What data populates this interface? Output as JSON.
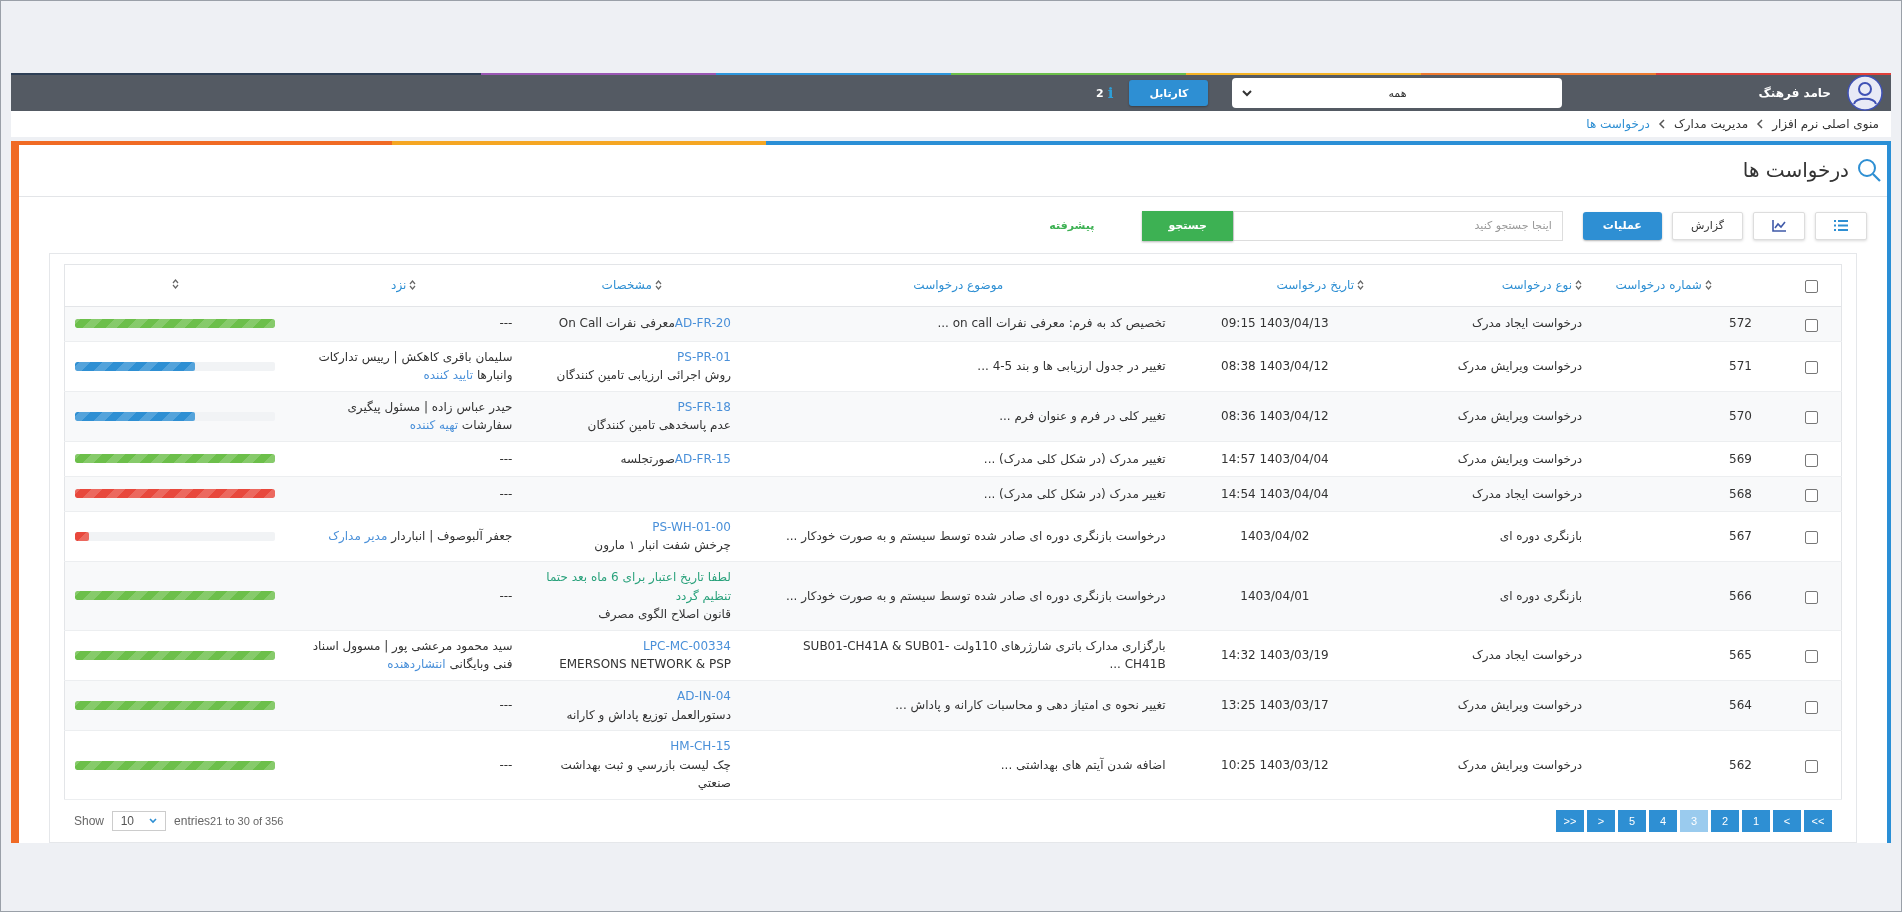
{
  "topbar": {
    "user_name": "حامد فرهنگ",
    "filter": {
      "value": "همه"
    },
    "cartable_button": "کارتابل",
    "notification_count": "2",
    "info_glyph": "i"
  },
  "breadcrumb": [
    {
      "label": "منوی اصلی نرم افزار",
      "current": false
    },
    {
      "label": "مدیریت مدارک",
      "current": false
    },
    {
      "label": "درخواست ها",
      "current": true
    }
  ],
  "page_title": "درخواست ها",
  "toolbar": {
    "view_buttons": [
      {
        "kind": "list"
      },
      {
        "kind": "chart"
      }
    ],
    "report_button": "گزارش",
    "operations_button": "عملیات",
    "search": {
      "placeholder": "اینجا جستجو کنید"
    },
    "search_button": "جستجو",
    "advanced_link": "پیشرفته"
  },
  "table": {
    "select_all": {
      "checked": false
    },
    "columns": [
      {
        "label": "شماره درخواست",
        "sortable": true
      },
      {
        "label": "نوع درخواست",
        "sortable": true
      },
      {
        "label": "تاریخ درخواست",
        "sortable": true
      },
      {
        "label": "موضوع درخواست",
        "sortable": false
      },
      {
        "label": "مشخصات",
        "sortable": true
      },
      {
        "label": "نزد",
        "sortable": true
      },
      {
        "sortable": true
      }
    ],
    "rows": [
      {
        "checked": false,
        "number": "572",
        "type": "درخواست ایجاد مدرک",
        "date": "1403/04/13 09:15",
        "subject": "تخصیص کد به فرم: معرفی نفرات on call ...",
        "spec": {
          "kind": "inline",
          "code": "AD-FR-20",
          "title": "معرفی نفرات On Call"
        },
        "holder": null,
        "progress": {
          "level": 1,
          "color": "#6cbf4a"
        }
      },
      {
        "checked": false,
        "number": "571",
        "type": "درخواست ویرایش مدرک",
        "date": "1403/04/12 08:38",
        "subject": "تغییر در جدول ارزیابی ها و بند 5-4 ...",
        "spec": {
          "kind": "stacked",
          "code": "PS-PR-01",
          "title": "روش اجرائی ارزیابی تامین کنندگان"
        },
        "holder": {
          "person": "سلیمان باقری کاهکش | رییس تدارکات وانبارها",
          "role": "تایید کننده"
        },
        "progress": {
          "level": 0.6,
          "color": "#2e8fd3"
        }
      },
      {
        "checked": false,
        "number": "570",
        "type": "درخواست ویرایش مدرک",
        "date": "1403/04/12 08:36",
        "subject": "تغییر کلی در فرم و عنوان فرم ...",
        "spec": {
          "kind": "stacked",
          "code": "PS-FR-18",
          "title": "عدم پاسخدهی تامین کنندگان"
        },
        "holder": {
          "person": "حیدر عباس زاده | مسئول پیگیری سفارشات",
          "role": "تهیه کننده"
        },
        "progress": {
          "level": 0.6,
          "color": "#2e8fd3"
        }
      },
      {
        "checked": false,
        "number": "569",
        "type": "درخواست ویرایش مدرک",
        "date": "1403/04/04 14:57",
        "subject": "تغییر مدرک (در شکل کلی مدرک) ...",
        "spec": {
          "kind": "inline",
          "code": "AD-FR-15",
          "title": "صورتجلسه"
        },
        "holder": null,
        "progress": {
          "level": 1,
          "color": "#6cbf4a"
        }
      },
      {
        "checked": false,
        "number": "568",
        "type": "درخواست ایجاد مدرک",
        "date": "1403/04/04 14:54",
        "subject": "تغییر مدرک (در شکل کلی مدرک) ...",
        "spec": null,
        "holder": null,
        "progress": {
          "level": 1,
          "color": "#e8483c"
        }
      },
      {
        "checked": false,
        "number": "567",
        "type": "بازنگری دوره ای",
        "date": "1403/04/02",
        "subject": "درخواست بازنگری دوره ای صادر شده توسط سیستم و به صورت خودکار ...",
        "spec": {
          "kind": "stacked",
          "code": "PS-WH-01-00",
          "title": "چرخش شفت انبار ۱ مارون"
        },
        "holder": {
          "person": "جعفر آلبوصوف | انباردار",
          "role": "مدیر مدارک"
        },
        "progress": {
          "level": 0.07,
          "color": "#e8483c"
        }
      },
      {
        "checked": false,
        "number": "566",
        "type": "بازنگری دوره ای",
        "date": "1403/04/01",
        "subject": "درخواست بازنگری دوره ای صادر شده توسط سیستم و به صورت خودکار ...",
        "spec": {
          "kind": "notice",
          "notice": "لطفا تاریخ اعتبار برای 6 ماه بعد حتما تنظیم گردد",
          "title": "قانون اصلاح الگوی مصرف"
        },
        "holder": null,
        "progress": {
          "level": 1,
          "color": "#6cbf4a"
        }
      },
      {
        "checked": false,
        "number": "565",
        "type": "درخواست ایجاد مدرک",
        "date": "1403/03/19 14:32",
        "subject": "بارگزاری مدارک باتری شارژرهای 110ولت SUB01-CH41A & SUB01-CH41B ...",
        "spec": {
          "kind": "stacked",
          "code": "LPC-MC-00334",
          "title": "EMERSONS NETWORK & PSP"
        },
        "holder": {
          "person": "سید محمود مرعشی پور | مسوول اسناد فنی وبایگانی",
          "role": "انتشاردهنده"
        },
        "progress": {
          "level": 1,
          "color": "#6cbf4a"
        }
      },
      {
        "checked": false,
        "number": "564",
        "type": "درخواست ویرایش مدرک",
        "date": "1403/03/17 13:25",
        "subject": "تغییر نحوه ی امتیاز دهی و محاسبات کارانه و پاداش ...",
        "spec": {
          "kind": "stacked",
          "code": "AD-IN-04",
          "title": "دستورالعمل توزیع پاداش و کارانه"
        },
        "holder": null,
        "progress": {
          "level": 1,
          "color": "#6cbf4a"
        }
      },
      {
        "checked": false,
        "number": "562",
        "type": "درخواست ویرایش مدرک",
        "date": "1403/03/12 10:25",
        "subject": "اضافه شدن آیتم های بهداشتی ...",
        "spec": {
          "kind": "stacked",
          "code": "HM-CH-15",
          "title": "چک ليست بازرسي و ثبت بهداشت صنعتي"
        },
        "holder": null,
        "progress": {
          "level": 1,
          "color": "#6cbf4a"
        }
      }
    ],
    "empty_holder": "---"
  },
  "footer": {
    "show_label": "Show",
    "page_size": "10",
    "entries_label": "entries",
    "range": "21 to 30 of 356"
  },
  "pagination": [
    {
      "label": ">>",
      "selected": false
    },
    {
      "label": ">",
      "selected": false
    },
    {
      "label": "1",
      "selected": false
    },
    {
      "label": "2",
      "selected": false
    },
    {
      "label": "3",
      "selected": true
    },
    {
      "label": "4",
      "selected": false
    },
    {
      "label": "5",
      "selected": false
    },
    {
      "label": "<",
      "selected": false
    },
    {
      "label": "<<",
      "selected": false
    }
  ]
}
